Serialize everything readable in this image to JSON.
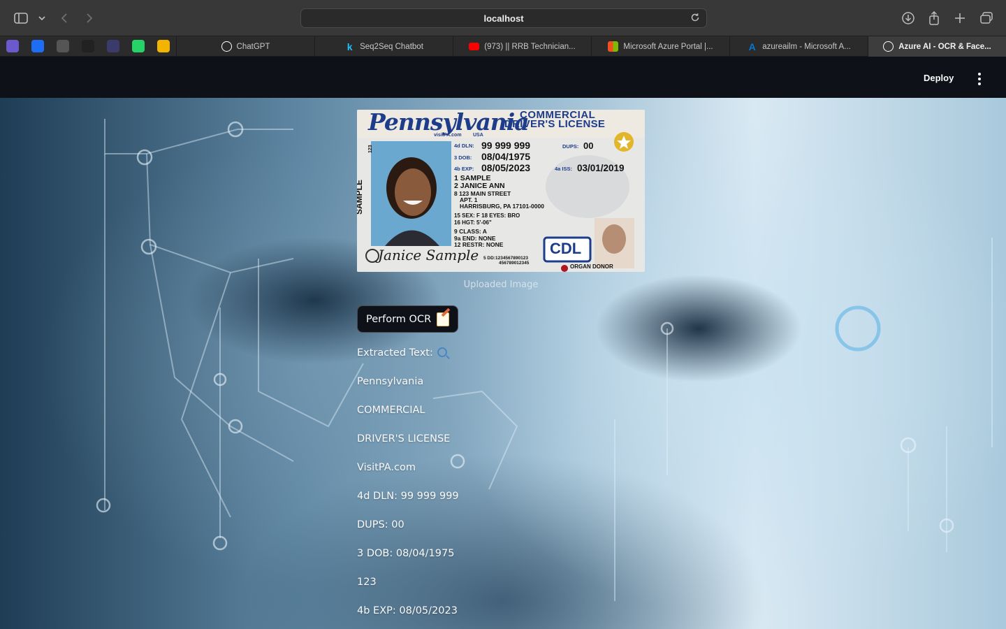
{
  "browser": {
    "address": "localhost",
    "bookmarks": [
      {
        "icon": "app-icon",
        "color": "#6a5acd"
      },
      {
        "icon": "play-icon",
        "color": "#1e6ef5"
      },
      {
        "icon": "app-icon",
        "color": "#555555"
      },
      {
        "icon": "github-icon",
        "color": "#222222"
      },
      {
        "icon": "app-icon",
        "color": "#3b3b6b"
      },
      {
        "icon": "whatsapp-icon",
        "color": "#25d366"
      },
      {
        "icon": "app-icon",
        "color": "#f3b400"
      }
    ],
    "tabs": [
      {
        "label": "ChatGPT",
        "icon": "chatgpt-icon",
        "active": false
      },
      {
        "label": "Seq2Seq Chatbot",
        "icon": "kaggle-icon",
        "active": false
      },
      {
        "label": "(973) || RRB Technician...",
        "icon": "youtube-icon",
        "active": false
      },
      {
        "label": "Microsoft Azure Portal |...",
        "icon": "microsoft-icon",
        "active": false
      },
      {
        "label": "azureailm - Microsoft A...",
        "icon": "azure-icon",
        "active": false
      },
      {
        "label": "Azure AI - OCR & Face...",
        "icon": "streamlit-icon",
        "active": true
      }
    ]
  },
  "header": {
    "deploy_label": "Deploy"
  },
  "main": {
    "caption": "Uploaded Image",
    "ocr_button_label": "Perform OCR",
    "extracted_heading": "Extracted Text:",
    "extracted_lines": [
      "Pennsylvania",
      "COMMERCIAL",
      "DRIVER'S LICENSE",
      "VisitPA.com",
      "4d DLN: 99 999 999",
      "DUPS: 00",
      "3 DOB: 08/04/1975",
      "123",
      "4b EXP: 08/05/2023"
    ]
  },
  "license": {
    "state": "Pennsylvania",
    "site": "visitPA.com",
    "country": "USA",
    "title_line1": "COMMERCIAL",
    "title_line2": "DRIVER'S LICENSE",
    "dln_label": "4d DLN:",
    "dln": "99 999 999",
    "dups_label": "DUPS:",
    "dups": "00",
    "dob_label": "3  DOB:",
    "dob": "08/04/1975",
    "exp_label": "4b EXP:",
    "exp": "08/05/2023",
    "iss_label": "4a ISS:",
    "iss": "03/01/2019",
    "last": "1 SAMPLE",
    "first": "2 JANICE ANN",
    "street": "8 123 MAIN STREET",
    "apt": "APT. 1",
    "city": "HARRISBURG, PA 17101-0000",
    "sex": "15 SEX: F    18 EYES: BRO",
    "hgt": "16 HGT: 5'-06\"",
    "class": "9  CLASS: A",
    "end": "9a END: NONE",
    "restr": "12 RESTR: NONE",
    "dd": "5 DD:1234567890123",
    "dd2": "456789012345",
    "cdl": "CDL",
    "donor": "ORGAN DONOR",
    "side_text": "SAMPLE",
    "num": "123",
    "signature": "Janice Sample"
  }
}
